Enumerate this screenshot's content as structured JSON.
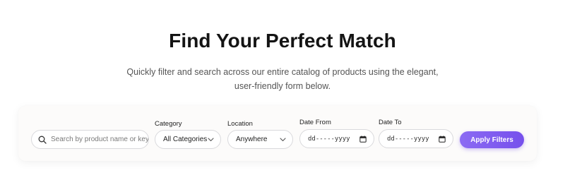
{
  "header": {
    "title": "Find Your Perfect Match",
    "subtitle": "Quickly filter and search across our entire catalog of products using the elegant, user-friendly form below."
  },
  "filters": {
    "search": {
      "placeholder": "Search by product name or keyword",
      "value": "",
      "icon": "search-icon"
    },
    "category": {
      "label": "Category",
      "selected": "All Categories",
      "icon": "chevron-down-icon"
    },
    "location": {
      "label": "Location",
      "selected": "Anywhere",
      "icon": "chevron-down-icon"
    },
    "date_from": {
      "label": "Date From",
      "value": "dd-----yyyy",
      "icon": "calendar-icon"
    },
    "date_to": {
      "label": "Date To",
      "value": "dd-----yyyy",
      "icon": "calendar-icon"
    },
    "apply_label": "Apply Filters"
  },
  "colors": {
    "accent": "#7650ec",
    "title": "#141414",
    "subtitle": "#555555",
    "card_bg": "#fcfbfa",
    "field_border": "#d9d9dc"
  }
}
